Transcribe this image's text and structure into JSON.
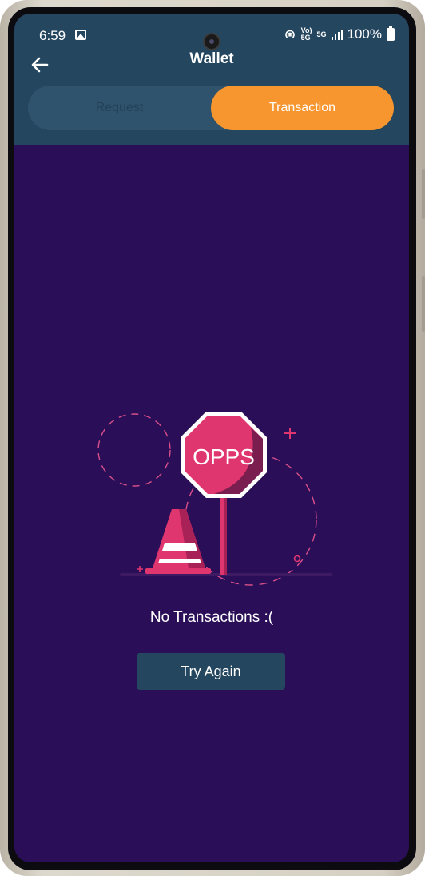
{
  "status_bar": {
    "time": "6:59",
    "volte": "Vo))\n5G",
    "network": "5G",
    "battery": "100%"
  },
  "header": {
    "title": "Wallet"
  },
  "tabs": [
    {
      "label": "Request",
      "active": false
    },
    {
      "label": "Transaction",
      "active": true
    }
  ],
  "illustration": {
    "sign_text": "OPPS"
  },
  "empty_state": {
    "message": "No Transactions :(",
    "button_label": "Try Again"
  },
  "colors": {
    "header_bg": "#25465f",
    "page_bg": "#2a0f58",
    "accent": "#f7962e",
    "sign_pink": "#e0366f"
  }
}
